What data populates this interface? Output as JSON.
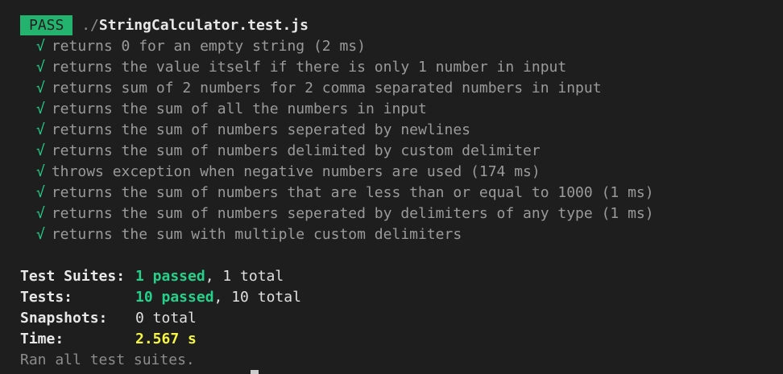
{
  "header": {
    "badge": "PASS",
    "path_prefix": " ./",
    "file_name": "StringCalculator.test.js"
  },
  "tests": [
    {
      "check": "√",
      "text": "returns 0 for an empty string (2 ms)"
    },
    {
      "check": "√",
      "text": "returns the value itself if there is only 1 number in input"
    },
    {
      "check": "√",
      "text": "returns sum of 2 numbers for 2 comma separated numbers in input"
    },
    {
      "check": "√",
      "text": "returns the sum of all the numbers in input"
    },
    {
      "check": "√",
      "text": "returns the sum of numbers seperated by newlines"
    },
    {
      "check": "√",
      "text": "returns the sum of numbers delimited by custom delimiter"
    },
    {
      "check": "√",
      "text": "throws exception when negative numbers are used (174 ms)"
    },
    {
      "check": "√",
      "text": "returns the sum of numbers that are less than or equal to 1000 (1 ms)"
    },
    {
      "check": "√",
      "text": "returns the sum of numbers seperated by delimiters of any type (1 ms)"
    },
    {
      "check": "√",
      "text": "returns the sum with multiple custom delimiters"
    }
  ],
  "summary": {
    "suites_label": "Test Suites:",
    "suites_passed": "1 passed",
    "suites_total": ", 1 total",
    "tests_label": "Tests:",
    "tests_passed": "10 passed",
    "tests_total": ", 10 total",
    "snapshots_label": "Snapshots:",
    "snapshots_value": "0 total",
    "time_label": "Time:",
    "time_value": "2.567 s",
    "ran_all": "Ran all test suites."
  },
  "colors": {
    "background": "#1e1e1e",
    "pass_badge": "#23b36e",
    "success_green": "#23d18b",
    "time_yellow": "#f5f543"
  }
}
